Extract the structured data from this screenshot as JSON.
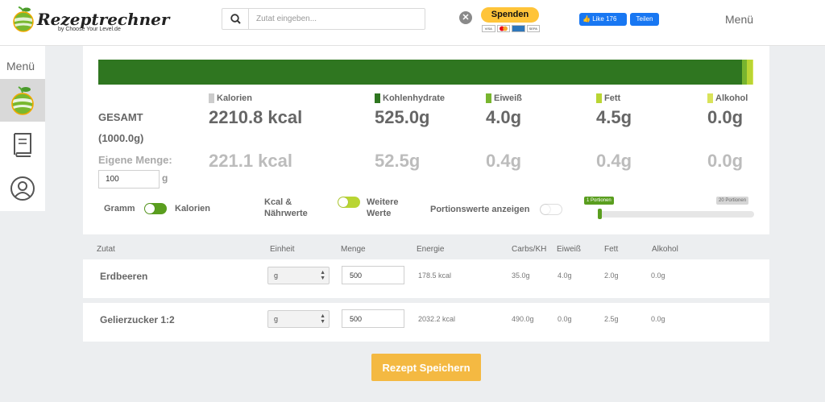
{
  "header": {
    "logo_title": "Rezeptrechner",
    "logo_sub": "by Choose Your Level.de",
    "search_placeholder": "Zutat eingeben...",
    "donate_label": "Spenden",
    "donate_cards": [
      "VISA",
      "MC",
      "",
      "SEPA"
    ],
    "fb_like_label": "Like 176",
    "fb_share_label": "Teilen",
    "menu_label": "Menü"
  },
  "sidebar": {
    "menu_label": "Menü",
    "items": [
      {
        "icon": "apple-icon",
        "active": true
      },
      {
        "icon": "book-icon",
        "active": false
      },
      {
        "icon": "user-icon",
        "active": false
      }
    ]
  },
  "summary": {
    "distribution": [
      {
        "name": "Kohlenhydrate",
        "fraction": 0.9825,
        "color": "#2f7620"
      },
      {
        "name": "Eiweiß",
        "fraction": 0.0075,
        "color": "#78b52f"
      },
      {
        "name": "Fett",
        "fraction": 0.0085,
        "color": "#b9d533"
      },
      {
        "name": "Alkohol",
        "fraction": 0.0015,
        "color": "#d9e35a"
      }
    ],
    "gesamt_label": "GESAMT",
    "gesamt_weight": "(1000.0g)",
    "own_label": "Eigene Menge:",
    "own_amount": "100",
    "own_unit": "g",
    "nutrients": [
      {
        "name": "Kalorien",
        "color": "#cccccc",
        "total": "2210.8 kcal",
        "own": "221.1 kcal"
      },
      {
        "name": "Kohlenhydrate",
        "color": "#2f7620",
        "total": "525.0g",
        "own": "52.5g"
      },
      {
        "name": "Eiweiß",
        "color": "#78b52f",
        "total": "4.0g",
        "own": "0.4g"
      },
      {
        "name": "Fett",
        "color": "#b9d533",
        "total": "4.5g",
        "own": "0.4g"
      },
      {
        "name": "Alkohol",
        "color": "#d9e35a",
        "total": "0.0g",
        "own": "0.0g"
      }
    ],
    "toggles": {
      "gramm_label": "Gramm",
      "kalorien_label": "Kalorien",
      "kcal_label_1": "Kcal &",
      "kcal_label_2": "Nährwerte",
      "weitere_label_1": "Weitere",
      "weitere_label_2": "Werte",
      "portion_label": "Portionswerte anzeigen"
    },
    "portions": {
      "min_label": "1 Portionen",
      "max_label": "20 Portionen",
      "value": 1,
      "min": 1,
      "max": 20
    }
  },
  "table": {
    "headers": [
      "Zutat",
      "Einheit",
      "Menge",
      "Energie",
      "Carbs/KH",
      "Eiweiß",
      "Fett",
      "Alkohol"
    ],
    "rows": [
      {
        "name": "Erdbeeren",
        "unit": "g",
        "amount": "500",
        "energy": "178.5 kcal",
        "carbs": "35.0g",
        "protein": "4.0g",
        "fat": "2.0g",
        "alcohol": "0.0g"
      },
      {
        "name": "Gelierzucker 1:2",
        "unit": "g",
        "amount": "500",
        "energy": "2032.2 kcal",
        "carbs": "490.0g",
        "protein": "0.0g",
        "fat": "2.5g",
        "alcohol": "0.0g"
      }
    ]
  },
  "save_label": "Rezept Speichern",
  "colors": {
    "accent_green": "#5a9e1f",
    "save_button": "#f4b942",
    "facebook": "#1877f2",
    "paypal": "#ffc439"
  }
}
